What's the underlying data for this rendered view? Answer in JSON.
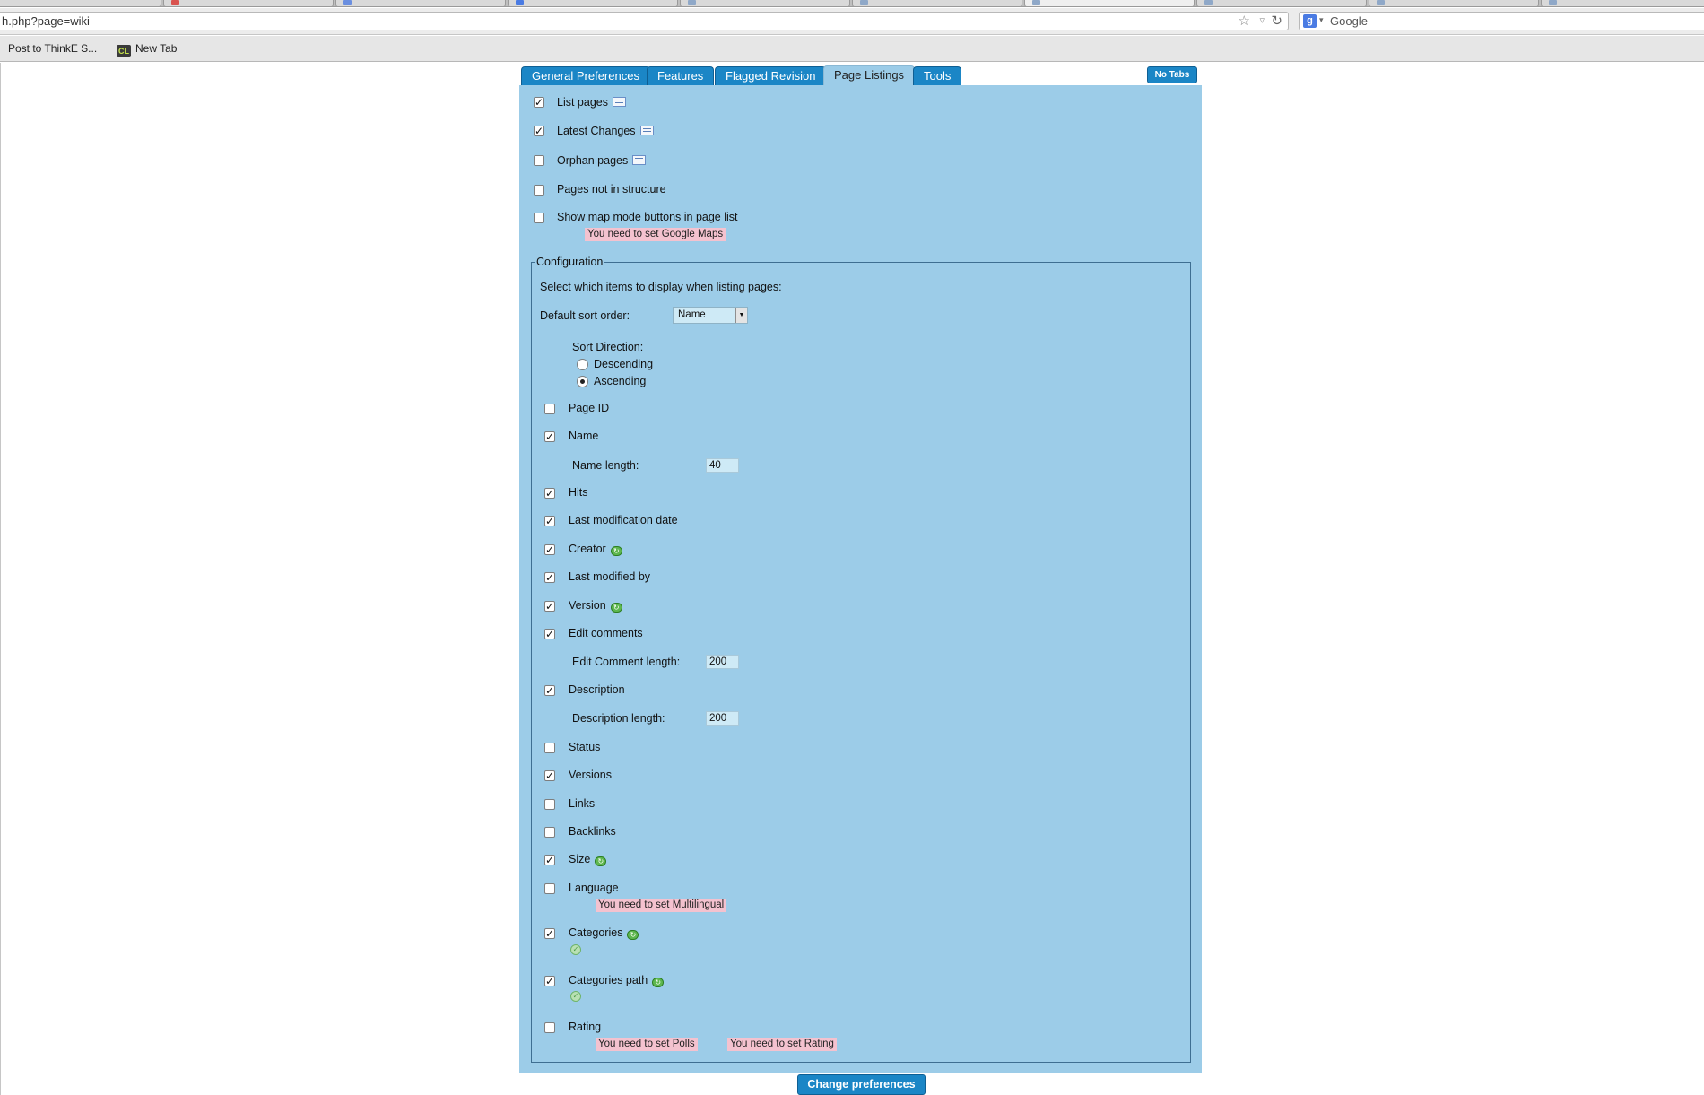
{
  "browser": {
    "url": "h.php?page=wiki",
    "search_engine_placeholder": "Google",
    "bookmarks": [
      {
        "label": "Post to ThinkE S..."
      },
      {
        "label": "New Tab",
        "icon_text": "CL"
      }
    ]
  },
  "tabs": {
    "items": [
      {
        "label": "General Preferences"
      },
      {
        "label": "Features"
      },
      {
        "label": "Flagged Revision"
      },
      {
        "label": "Page Listings",
        "active": true
      },
      {
        "label": "Tools"
      }
    ],
    "no_tabs_label": "No Tabs"
  },
  "top_options": [
    {
      "label": "List pages",
      "checked": true,
      "icon": "feature-list-icon"
    },
    {
      "label": "Latest Changes",
      "checked": true,
      "icon": "feature-list-icon"
    },
    {
      "label": "Orphan pages",
      "checked": false,
      "icon": "feature-list-icon"
    },
    {
      "label": "Pages not in structure",
      "checked": false
    },
    {
      "label": "Show map mode buttons in page list",
      "checked": false
    }
  ],
  "warnings": {
    "google_maps": "You need to set Google Maps",
    "multilingual": "You need to set Multilingual",
    "polls": "You need to set Polls",
    "rating": "You need to set Rating"
  },
  "configuration": {
    "legend": "Configuration",
    "intro": "Select which items to display when listing pages:",
    "sort_order_label": "Default sort order:",
    "sort_order_value": "Name",
    "sort_direction_label": "Sort Direction:",
    "sort_direction_options": [
      {
        "label": "Descending",
        "selected": false
      },
      {
        "label": "Ascending",
        "selected": true
      }
    ],
    "name_length_label": "Name length:",
    "name_length_value": "40",
    "edit_comment_length_label": "Edit Comment length:",
    "edit_comment_length_value": "200",
    "description_length_label": "Description length:",
    "description_length_value": "200"
  },
  "columns": [
    {
      "label": "Page ID",
      "checked": false
    },
    {
      "label": "Name",
      "checked": true
    },
    {
      "label": "Hits",
      "checked": true
    },
    {
      "label": "Last modification date",
      "checked": true
    },
    {
      "label": "Creator",
      "checked": true,
      "icon": "recommended-icon"
    },
    {
      "label": "Last modified by",
      "checked": true
    },
    {
      "label": "Version",
      "checked": true,
      "icon": "recommended-icon"
    },
    {
      "label": "Edit comments",
      "checked": true
    },
    {
      "label": "Description",
      "checked": true
    },
    {
      "label": "Status",
      "checked": false
    },
    {
      "label": "Versions",
      "checked": true
    },
    {
      "label": "Links",
      "checked": false
    },
    {
      "label": "Backlinks",
      "checked": false
    },
    {
      "label": "Size",
      "checked": true,
      "icon": "recommended-icon"
    },
    {
      "label": "Language",
      "checked": false
    },
    {
      "label": "Categories",
      "checked": true,
      "icon": "recommended-icon"
    },
    {
      "label": "Categories path",
      "checked": true,
      "icon": "recommended-icon"
    },
    {
      "label": "Rating",
      "checked": false
    }
  ],
  "submit_label": "Change preferences",
  "colors": {
    "tab_blue": "#1b86c6",
    "panel_blue": "#9ccce8",
    "warning_pink": "#f4c2cf"
  }
}
